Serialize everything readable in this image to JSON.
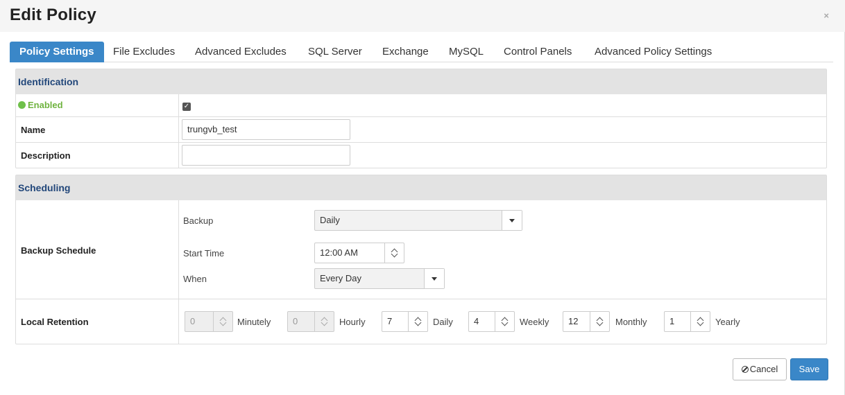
{
  "dialog": {
    "title": "Edit Policy",
    "close_glyph": "×"
  },
  "tabs": [
    {
      "label": "Policy Settings",
      "active": true
    },
    {
      "label": "File Excludes"
    },
    {
      "label": "Advanced Excludes"
    },
    {
      "label": "SQL Server"
    },
    {
      "label": "Exchange"
    },
    {
      "label": "MySQL"
    },
    {
      "label": "Control Panels"
    },
    {
      "label": "Advanced Policy Settings"
    }
  ],
  "identification": {
    "heading": "Identification",
    "enabled_label": "Enabled",
    "enabled_checked": true,
    "checkbox_glyph": "✓",
    "name_label": "Name",
    "name_value": "trungvb_test",
    "description_label": "Description",
    "description_value": ""
  },
  "scheduling": {
    "heading": "Scheduling",
    "backup_schedule_label": "Backup Schedule",
    "backup_label": "Backup",
    "backup_value": "Daily",
    "start_time_label": "Start Time",
    "start_time_value": "12:00 AM",
    "when_label": "When",
    "when_value": "Every Day"
  },
  "retention": {
    "label": "Local Retention",
    "minutely": {
      "value": "0",
      "label": "Minutely",
      "disabled": true
    },
    "hourly": {
      "value": "0",
      "label": "Hourly",
      "disabled": true
    },
    "daily": {
      "value": "7",
      "label": "Daily"
    },
    "weekly": {
      "value": "4",
      "label": "Weekly"
    },
    "monthly": {
      "value": "12",
      "label": "Monthly"
    },
    "yearly": {
      "value": "1",
      "label": "Yearly"
    }
  },
  "footer": {
    "cancel_label": "Cancel",
    "save_label": "Save"
  },
  "colors": {
    "accent": "#3a87c8",
    "enabled_green": "#6fc04a",
    "section_heading": "#22477a"
  }
}
